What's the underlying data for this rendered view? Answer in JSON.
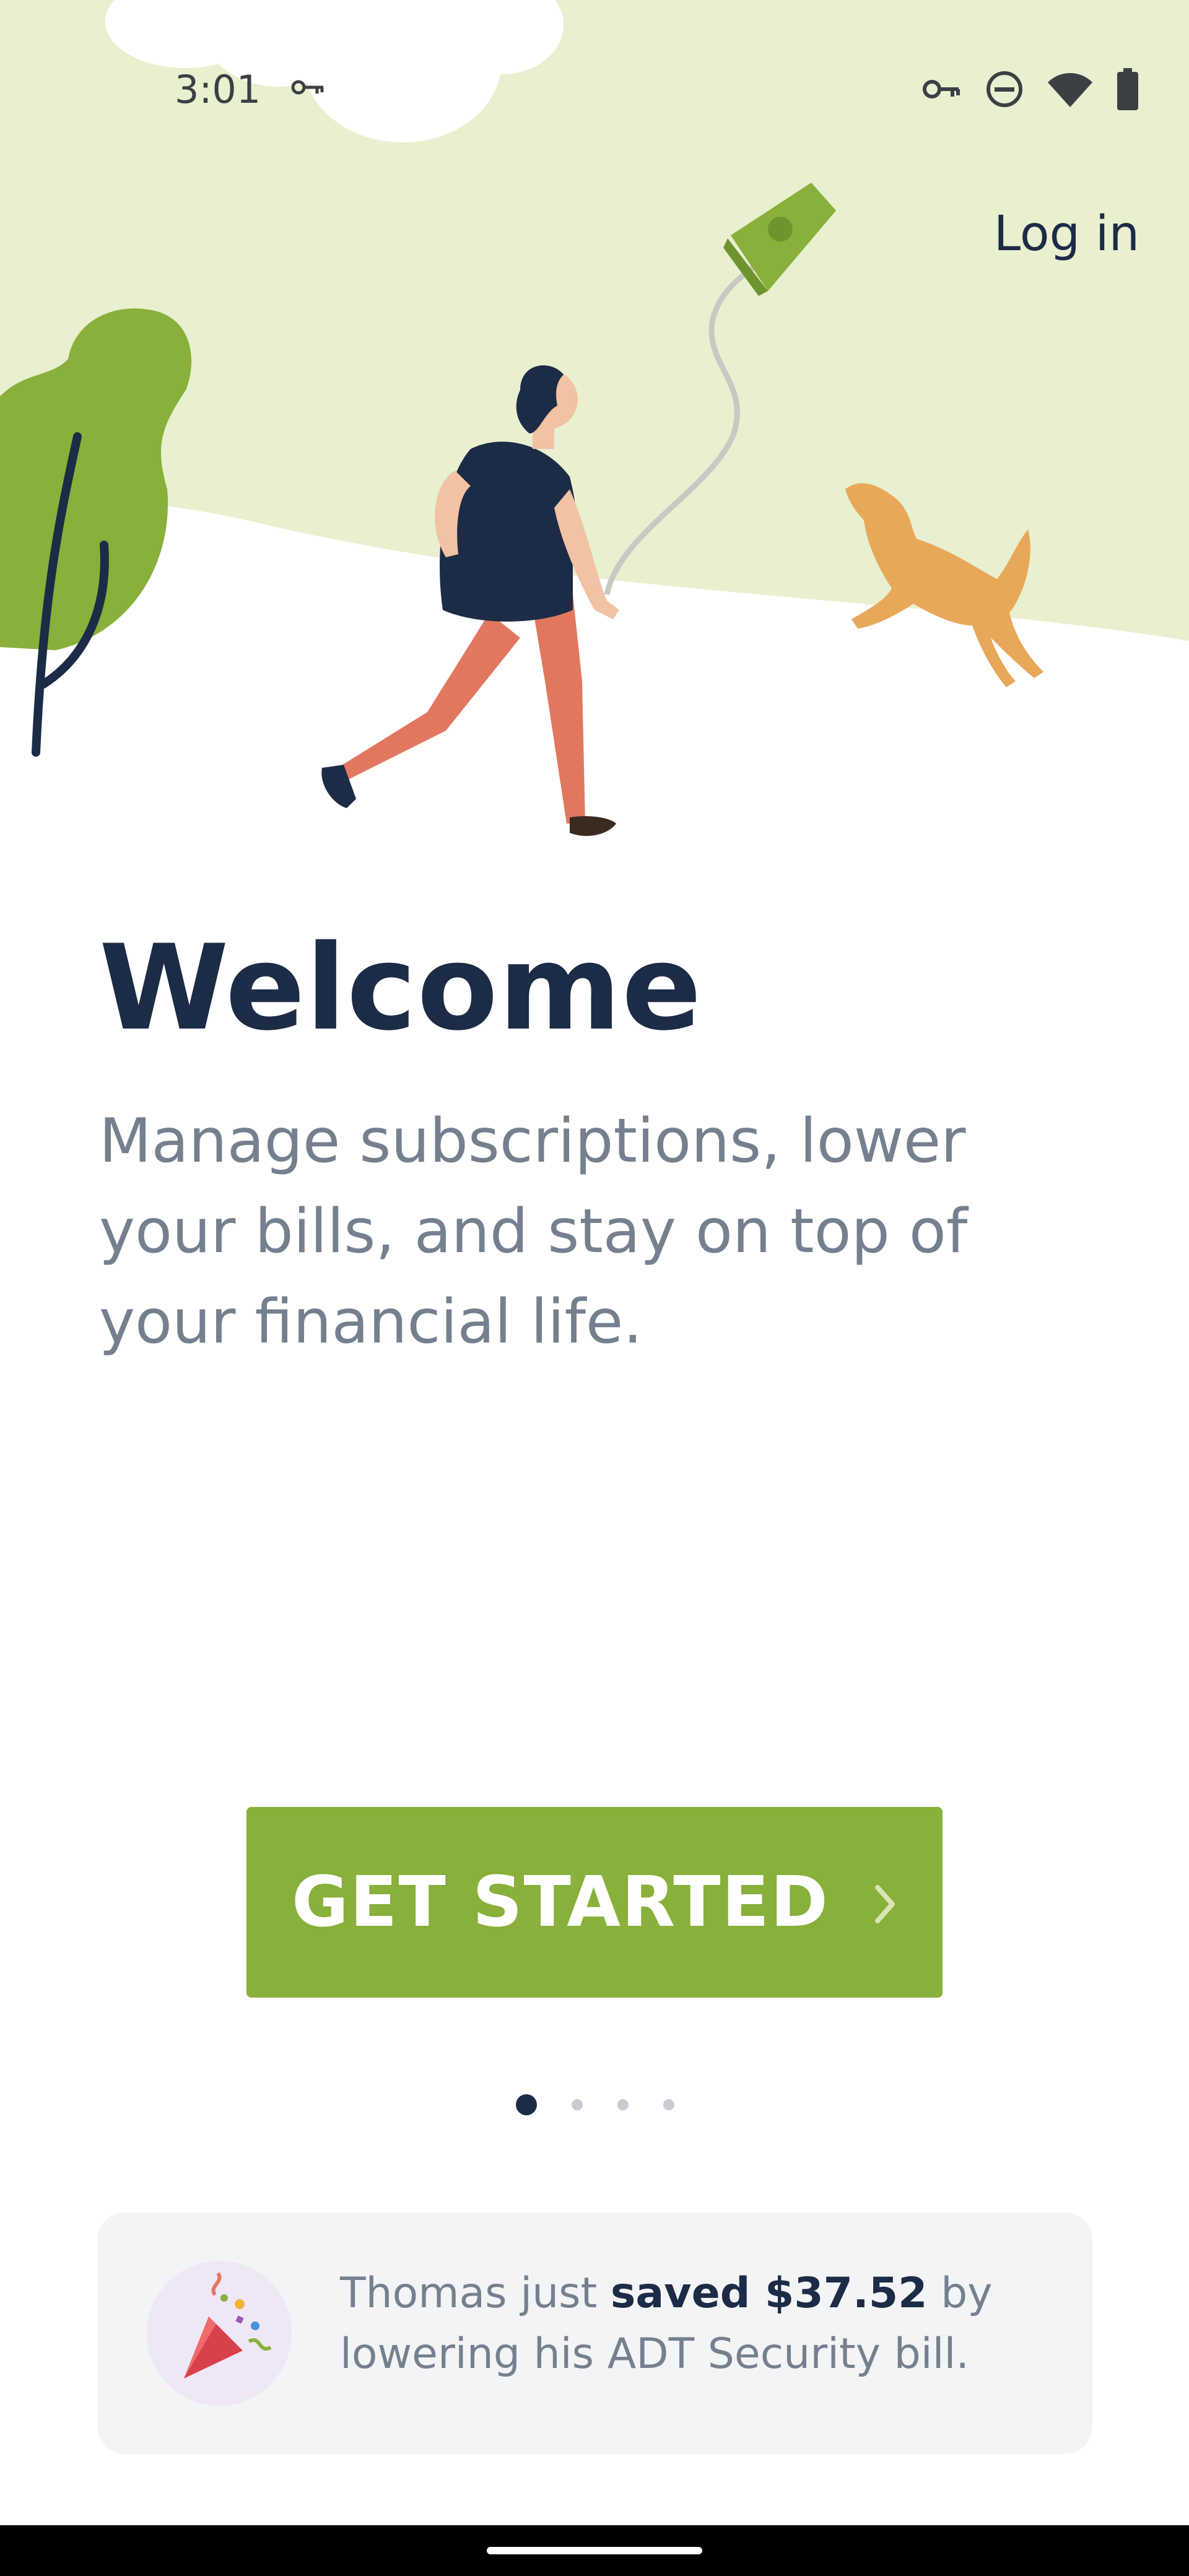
{
  "status_bar": {
    "time": "3:01",
    "icons": [
      "vpn-key-icon",
      "key-icon",
      "do-not-disturb-icon",
      "wifi-icon",
      "battery-icon"
    ]
  },
  "header": {
    "login_label": "Log in"
  },
  "main": {
    "title": "Welcome",
    "subtitle_lines": [
      "Manage subscriptions, lower",
      "your bills, and stay on top of",
      "your financial life."
    ],
    "cta_label": "GET STARTED",
    "cta_icon": "chevron-right-icon",
    "pager": {
      "count": 4,
      "active": 0
    }
  },
  "notification": {
    "icon": "party-popper-icon",
    "text_before": "Thomas just ",
    "text_bold": "saved $37.52",
    "text_after_line1": " by",
    "line2": "lowering his ADT Security bill."
  },
  "colors": {
    "brand_green": "#88b03a",
    "navy": "#1c2b46",
    "muted_text": "#75808f",
    "hero_bg": "#e8f0cf",
    "card_bg": "#f3f4f6"
  }
}
